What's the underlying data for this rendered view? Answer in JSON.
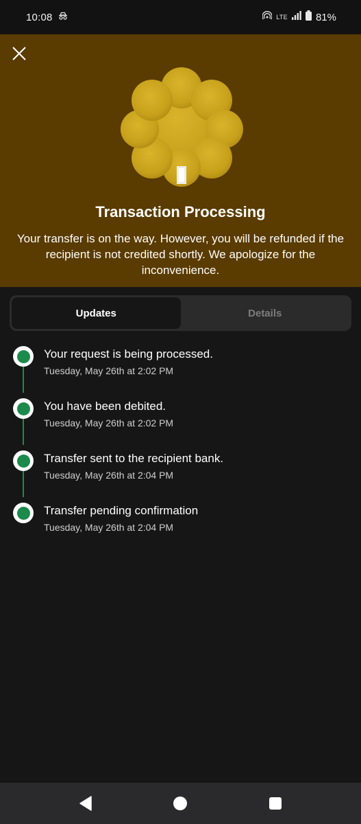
{
  "status_bar": {
    "time": "10:08",
    "network": "LTE",
    "battery": "81%"
  },
  "header": {
    "title": "Transaction Processing",
    "description": "Your transfer is on the way. However, you will be refunded if the recipient is not credited shortly. We apologize for the inconvenience.",
    "background": "#5a3b00"
  },
  "tabs": [
    {
      "label": "Updates",
      "active": true
    },
    {
      "label": "Details",
      "active": false
    }
  ],
  "timeline": [
    {
      "title": "Your request is being processed.",
      "time": "Tuesday, May 26th at 2:02 PM"
    },
    {
      "title": "You have been debited.",
      "time": "Tuesday, May 26th at 2:02 PM"
    },
    {
      "title": "Transfer sent to the recipient bank.",
      "time": "Tuesday, May 26th at 2:04 PM"
    },
    {
      "title": "Transfer pending confirmation",
      "time": "Tuesday, May 26th at 2:04 PM"
    }
  ],
  "icons": {
    "close": "close-icon",
    "hero": "processing-badge-icon",
    "back": "back-icon",
    "home": "home-icon",
    "recents": "recents-icon"
  },
  "colors": {
    "accent_green": "#1b8a4c",
    "badge_gold": "#c9a31f"
  }
}
